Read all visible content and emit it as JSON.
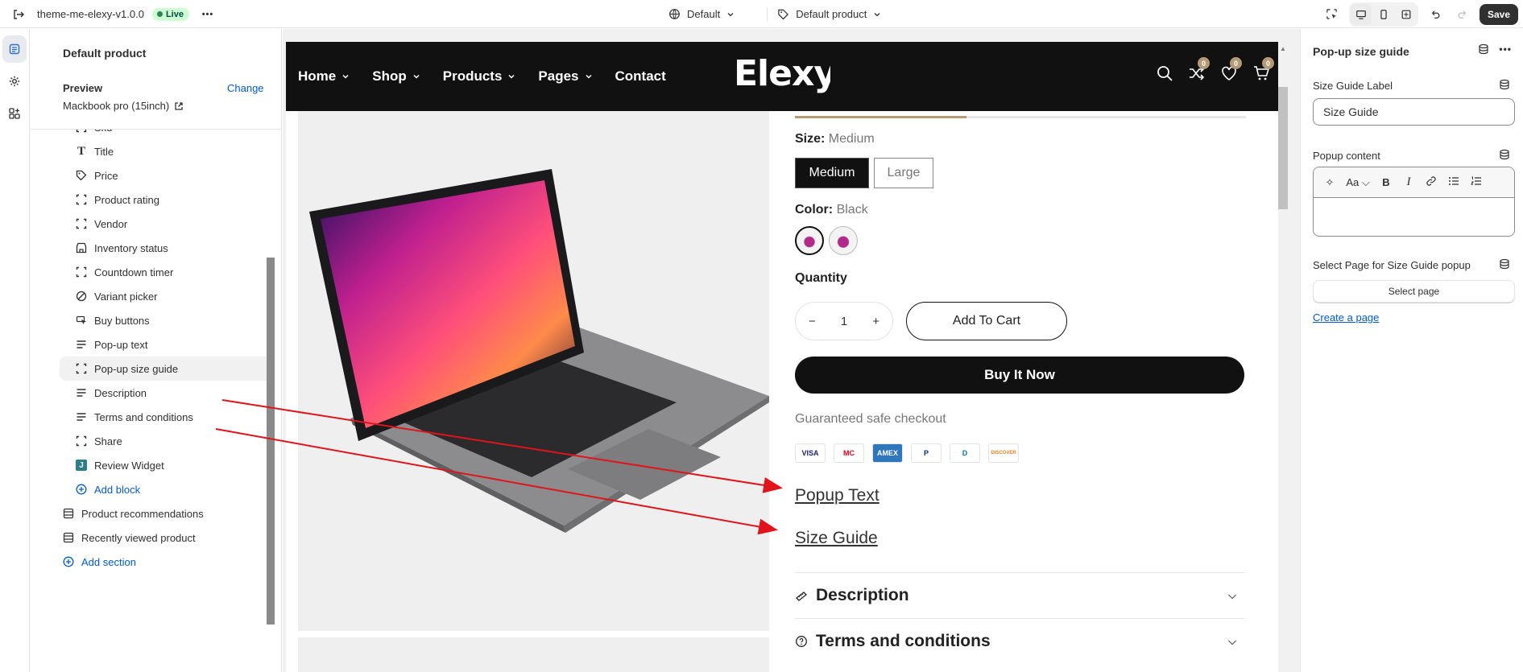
{
  "topbar": {
    "theme_name": "theme-me-elexy-v1.0.0",
    "status": "Live",
    "more": "•••",
    "template_selector": "Default",
    "page_selector": "Default product",
    "save_label": "Save"
  },
  "left_panel": {
    "title": "Default product",
    "preview_label": "Preview",
    "change_label": "Change",
    "preview_product": "Mackbook pro (15inch)",
    "blocks": [
      {
        "label": "Sku",
        "icon": "dashed-square-icon"
      },
      {
        "label": "Title",
        "icon": "text-icon"
      },
      {
        "label": "Price",
        "icon": "price-tag-icon"
      },
      {
        "label": "Product rating",
        "icon": "dashed-square-icon"
      },
      {
        "label": "Vendor",
        "icon": "dashed-square-icon"
      },
      {
        "label": "Inventory status",
        "icon": "store-icon"
      },
      {
        "label": "Countdown timer",
        "icon": "dashed-square-icon"
      },
      {
        "label": "Variant picker",
        "icon": "variant-icon"
      },
      {
        "label": "Buy buttons",
        "icon": "cursor-icon"
      },
      {
        "label": "Pop-up text",
        "icon": "text-lines-icon"
      },
      {
        "label": "Pop-up size guide",
        "icon": "dashed-square-icon"
      },
      {
        "label": "Description",
        "icon": "text-lines-icon"
      },
      {
        "label": "Terms and conditions",
        "icon": "text-lines-icon"
      },
      {
        "label": "Share",
        "icon": "dashed-square-icon"
      },
      {
        "label": "Review Widget",
        "icon": "app-j-icon"
      }
    ],
    "add_block": "Add block",
    "sections": [
      {
        "label": "Product recommendations",
        "icon": "section-icon"
      },
      {
        "label": "Recently viewed product",
        "icon": "section-icon"
      }
    ],
    "add_section": "Add section"
  },
  "store": {
    "nav": [
      "Home",
      "Shop",
      "Products",
      "Pages",
      "Contact"
    ],
    "logo": "Elexy",
    "badges": [
      "0",
      "0",
      "0"
    ],
    "size_label": "Size:",
    "size_value": "Medium",
    "sizes": [
      "Medium",
      "Large"
    ],
    "color_label": "Color:",
    "color_value": "Black",
    "quantity_label": "Quantity",
    "quantity_value": "1",
    "minus": "−",
    "plus": "+",
    "add_to_cart": "Add To Cart",
    "buy_now": "Buy It Now",
    "guaranteed": "Guaranteed safe checkout",
    "payments": [
      "VISA",
      "MC",
      "AMEX",
      "P",
      "D",
      "DISCOVER"
    ],
    "popup_text_link": "Popup Text",
    "size_guide_link": "Size Guide",
    "accordions": [
      "Description",
      "Terms and conditions"
    ],
    "image_progress": 0.38
  },
  "right_panel": {
    "title": "Pop-up size guide",
    "size_guide_label": "Size Guide Label",
    "size_guide_value": "Size Guide",
    "popup_content_label": "Popup content",
    "select_page_label": "Select Page for Size Guide popup",
    "select_page_button": "Select page",
    "create_page_link": "Create a page"
  },
  "colors": {
    "accent_blue": "#005bd3",
    "store_nav": "#111111",
    "badge": "#b49b75",
    "arrow": "#e0141a"
  }
}
